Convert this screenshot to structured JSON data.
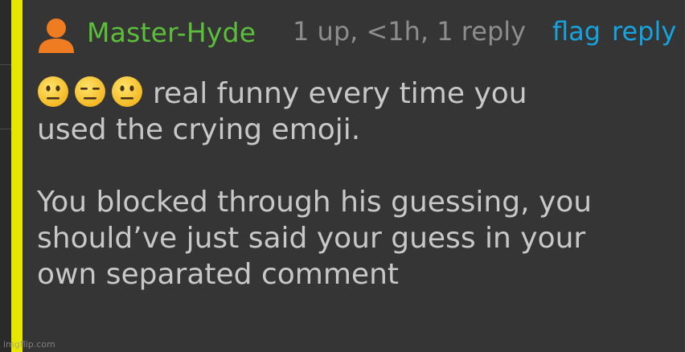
{
  "comment": {
    "username": "Master-Hyde",
    "meta": "1 up, <1h, 1 reply",
    "flag_label": "flag",
    "reply_label": "reply",
    "emojis": [
      "neutral-face",
      "expressionless-face",
      "neutral-face"
    ],
    "line1_text": "real funny every time you",
    "line2_text": "used the crying emoji.",
    "line3_text": "You blocked through his guessing, you",
    "line4_text": "should’ve just said your guess in your",
    "line5_text": "own separated comment"
  },
  "watermark": "imgflip.com",
  "colors": {
    "username": "#5bbf3a",
    "meta": "#8d8d8d",
    "action": "#16a4e0",
    "text": "#c8c8c8",
    "highlight_bar": "#e6e600",
    "avatar": "#f07c22",
    "background": "#353535"
  }
}
